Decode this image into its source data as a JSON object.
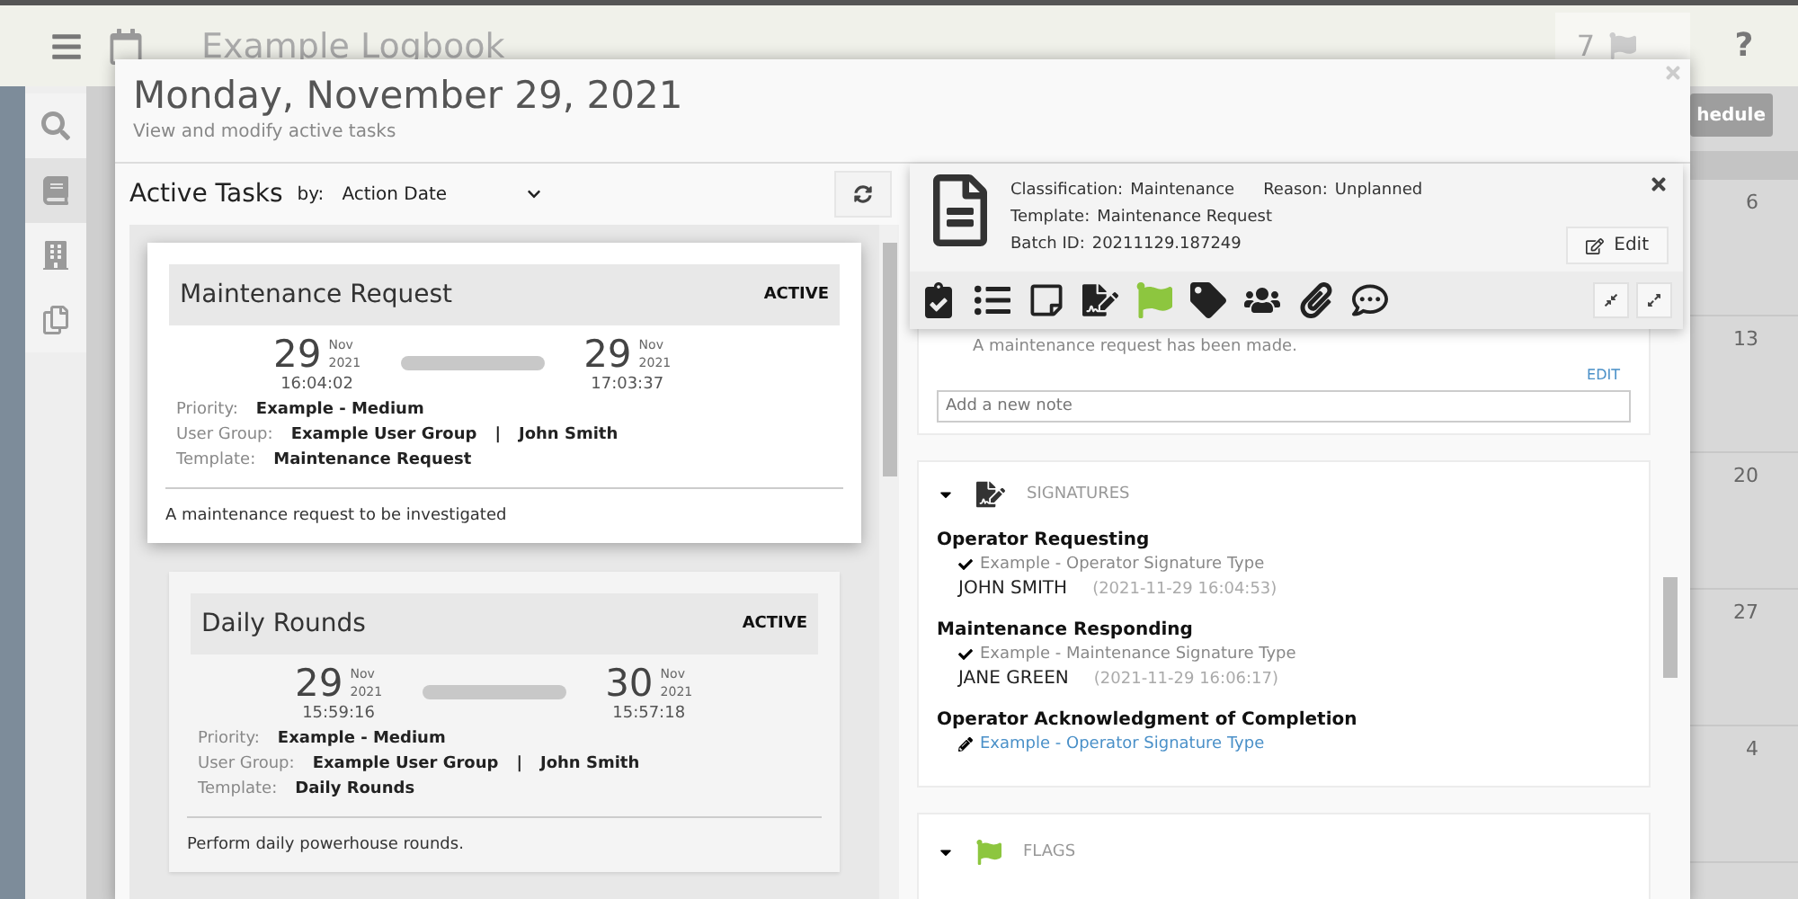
{
  "app": {
    "title": "Example Logbook",
    "flag_count": "7",
    "help": "?",
    "partial_button": "hedule",
    "calendar_days": [
      "6",
      "13",
      "20",
      "27",
      "4"
    ],
    "sidebar": [
      {
        "kind": "search",
        "selected": false
      },
      {
        "kind": "notebook",
        "selected": true
      },
      {
        "kind": "building",
        "selected": false
      },
      {
        "kind": "documents",
        "selected": false
      }
    ]
  },
  "dialog": {
    "title": "Monday, November 29, 2021",
    "subtitle": "View and modify active tasks"
  },
  "task_list": {
    "heading": "Active Tasks",
    "sort_label": "by:",
    "sort_value": "Action Date",
    "tasks": [
      {
        "title": "Maintenance Request",
        "status": "ACTIVE",
        "selected": true,
        "start": {
          "day": "29",
          "month": "Nov",
          "year": "2021",
          "time": "16:04:02"
        },
        "end": {
          "day": "29",
          "month": "Nov",
          "year": "2021",
          "time": "17:03:37"
        },
        "priority_label": "Priority:",
        "priority": "Example - Medium",
        "user_group_label": "User Group:",
        "user_group": "Example User Group",
        "separator": "|",
        "user": "John Smith",
        "template_label": "Template:",
        "template": "Maintenance Request",
        "description": "A maintenance request to be investigated"
      },
      {
        "title": "Daily Rounds",
        "status": "ACTIVE",
        "selected": false,
        "start": {
          "day": "29",
          "month": "Nov",
          "year": "2021",
          "time": "15:59:16"
        },
        "end": {
          "day": "30",
          "month": "Nov",
          "year": "2021",
          "time": "15:57:18"
        },
        "priority_label": "Priority:",
        "priority": "Example - Medium",
        "user_group_label": "User Group:",
        "user_group": "Example User Group",
        "separator": "|",
        "user": "John Smith",
        "template_label": "Template:",
        "template": "Daily Rounds",
        "description": "Perform daily powerhouse rounds."
      }
    ]
  },
  "detail": {
    "classification_label": "Classification:",
    "classification": "Maintenance",
    "reason_label": "Reason:",
    "reason": "Unplanned",
    "template_label": "Template:",
    "template": "Maintenance Request",
    "batch_label": "Batch ID:",
    "batch_id": "20211129.187249",
    "edit": "Edit",
    "tools": [
      {
        "kind": "clipboard"
      },
      {
        "kind": "list"
      },
      {
        "kind": "note"
      },
      {
        "kind": "signature"
      },
      {
        "kind": "flag"
      },
      {
        "kind": "tag"
      },
      {
        "kind": "users"
      },
      {
        "kind": "paperclip"
      },
      {
        "kind": "comment"
      }
    ]
  },
  "notes": {
    "text": "A maintenance request has been made.",
    "edit": "EDIT",
    "placeholder": "Add a new note"
  },
  "signatures": {
    "heading": "SIGNATURES",
    "expanded": true,
    "items": [
      {
        "title": "Operator Requesting",
        "kind": "signed",
        "type": "Example - Operator Signature Type",
        "signer": "JOHN SMITH",
        "timestamp": "(2021-11-29 16:04:53)"
      },
      {
        "title": "Maintenance Responding",
        "kind": "signed",
        "type": "Example - Maintenance Signature Type",
        "signer": "JANE GREEN",
        "timestamp": "(2021-11-29 16:06:17)"
      },
      {
        "title": "Operator Acknowledgment of Completion",
        "kind": "pending",
        "type": "Example - Operator Signature Type"
      }
    ]
  },
  "flags": {
    "heading": "FLAGS",
    "expanded": true
  }
}
